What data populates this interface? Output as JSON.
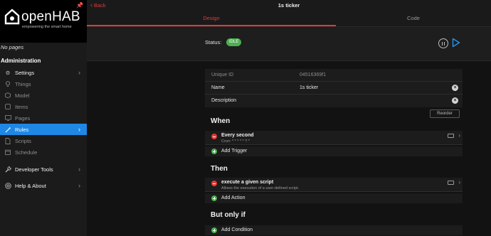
{
  "brand": {
    "name": "openHAB",
    "tagline": "empowering the smart home"
  },
  "sidebar": {
    "no_pages": "No pages",
    "section": "Administration",
    "items": [
      {
        "label": "Settings",
        "icon": "gear-icon"
      },
      {
        "label": "Things",
        "icon": "lightbulb-icon"
      },
      {
        "label": "Model",
        "icon": "cube-icon"
      },
      {
        "label": "Items",
        "icon": "square-icon"
      },
      {
        "label": "Pages",
        "icon": "desktop-icon"
      },
      {
        "label": "Rules",
        "icon": "wand-icon"
      },
      {
        "label": "Scripts",
        "icon": "doc-icon"
      },
      {
        "label": "Schedule",
        "icon": "calendar-icon"
      },
      {
        "label": "Developer Tools",
        "icon": "wrench-icon"
      },
      {
        "label": "Help & About",
        "icon": "help-icon"
      }
    ]
  },
  "header": {
    "back_label": "Back",
    "title": "1s ticker"
  },
  "tabs": {
    "design": "Design",
    "code": "Code"
  },
  "status": {
    "label": "Status:",
    "value": "IDLE"
  },
  "props": {
    "uid_label": "Unique ID",
    "uid_value": "04516369f1",
    "name_label": "Name",
    "name_value": "1s ticker",
    "description_label": "Description"
  },
  "reorder_label": "Reorder",
  "when": {
    "heading": "When",
    "items": [
      {
        "title": "Every second",
        "subtitle": "Cron: * * * * * ? *"
      }
    ],
    "add_label": "Add Trigger"
  },
  "then": {
    "heading": "Then",
    "items": [
      {
        "title": "execute a given script",
        "subtitle": "Allows the execution of a user-defined script."
      }
    ],
    "add_label": "Add Action"
  },
  "only_if": {
    "heading": "But only if",
    "add_label": "Add Condition"
  },
  "colors": {
    "accent": "#e53935",
    "active_nav": "#1f88e5",
    "status_idle": "#4caf50",
    "play": "#2196f3"
  }
}
